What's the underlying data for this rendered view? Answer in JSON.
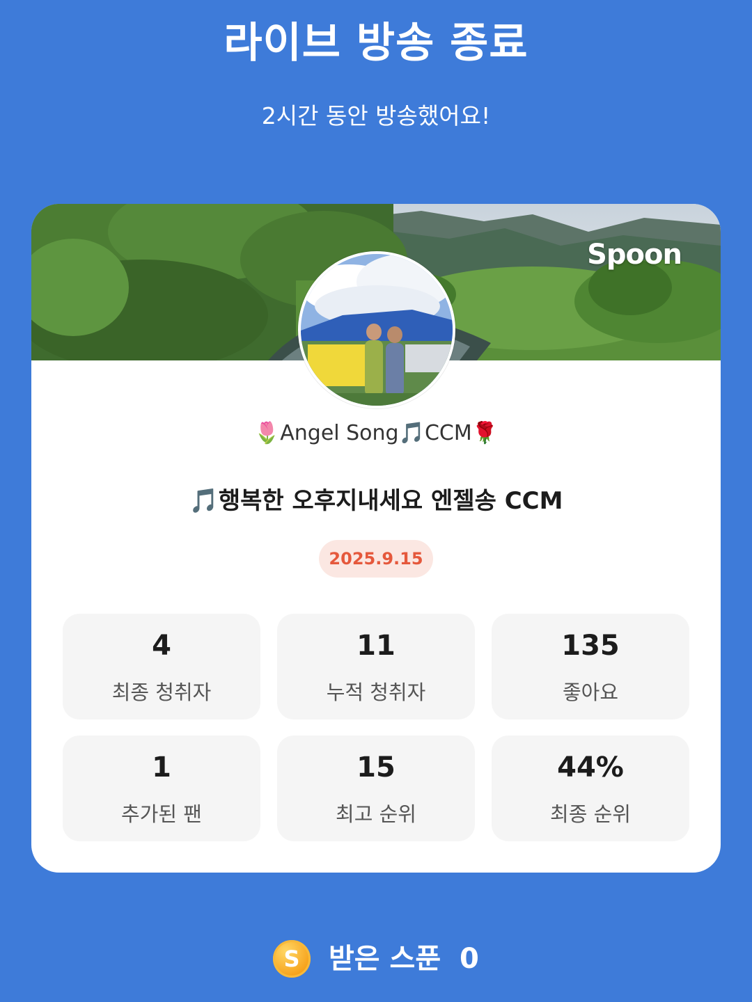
{
  "header": {
    "title": "라이브 방송 종료",
    "subtitle": "2시간 동안 방송했어요!"
  },
  "card": {
    "brand": "Spoon",
    "host": {
      "prefix_emoji": "🌷",
      "name_part1": "Angel Song",
      "mid_emoji": "🎵",
      "name_part2": "CCM",
      "suffix_emoji": "🌹"
    },
    "live_title": {
      "emoji": "🎵",
      "text": "행복한 오후지내세요 엔젤송 CCM"
    },
    "date": "2025.9.15",
    "stats": [
      {
        "value": "4",
        "label": "최종 청취자"
      },
      {
        "value": "11",
        "label": "누적 청취자"
      },
      {
        "value": "135",
        "label": "좋아요"
      },
      {
        "value": "1",
        "label": "추가된 팬"
      },
      {
        "value": "15",
        "label": "최고 순위"
      },
      {
        "value": "44%",
        "label": "최종 순위"
      }
    ]
  },
  "footer": {
    "coin_letter": "S",
    "received_label": "받은 스푼",
    "received_value": "0"
  },
  "colors": {
    "background": "#3e7bd9",
    "card": "#ffffff",
    "stat_box": "#f5f5f5",
    "date_badge_bg": "#fbe7e2",
    "date_badge_text": "#e5583c",
    "coin": "#f6a21b"
  }
}
